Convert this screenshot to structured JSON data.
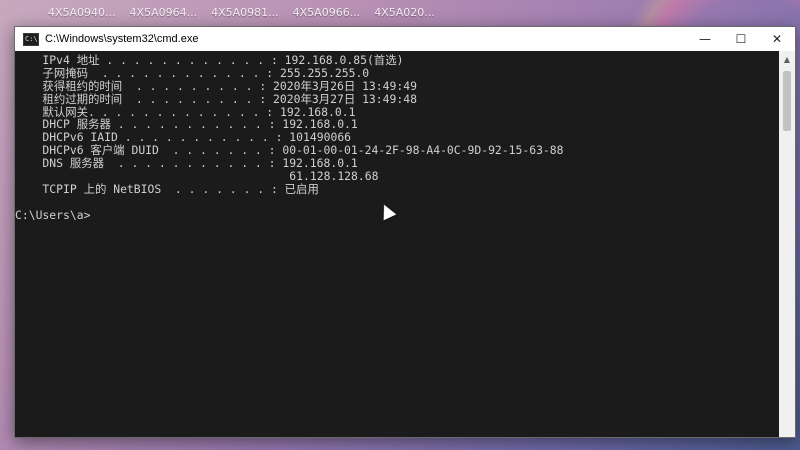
{
  "desktop": {
    "files": [
      "4X5A0940...",
      "4X5A0964...",
      "4X5A0981...",
      "4X5A0966...",
      "4X5A020..."
    ]
  },
  "window": {
    "title": "C:\\Windows\\system32\\cmd.exe",
    "icon_label": "C:\\",
    "controls": {
      "minimize": "—",
      "maximize": "☐",
      "close": "✕"
    }
  },
  "console": {
    "lines": [
      "    IPv4 地址 . . . . . . . . . . . . : 192.168.0.85(首选)",
      "    子网掩码  . . . . . . . . . . . . : 255.255.255.0",
      "    获得租约的时间  . . . . . . . . . : 2020年3月26日 13:49:49",
      "    租约过期的时间  . . . . . . . . . : 2020年3月27日 13:49:48",
      "    默认网关. . . . . . . . . . . . . : 192.168.0.1",
      "    DHCP 服务器 . . . . . . . . . . . : 192.168.0.1",
      "    DHCPv6 IAID . . . . . . . . . . . : 101490066",
      "    DHCPv6 客户端 DUID  . . . . . . . : 00-01-00-01-24-2F-98-A4-0C-9D-92-15-63-88",
      "    DNS 服务器  . . . . . . . . . . . : 192.168.0.1",
      "                                        61.128.128.68",
      "    TCPIP 上的 NetBIOS  . . . . . . . : 已启用",
      "",
      "C:\\Users\\a>"
    ]
  }
}
